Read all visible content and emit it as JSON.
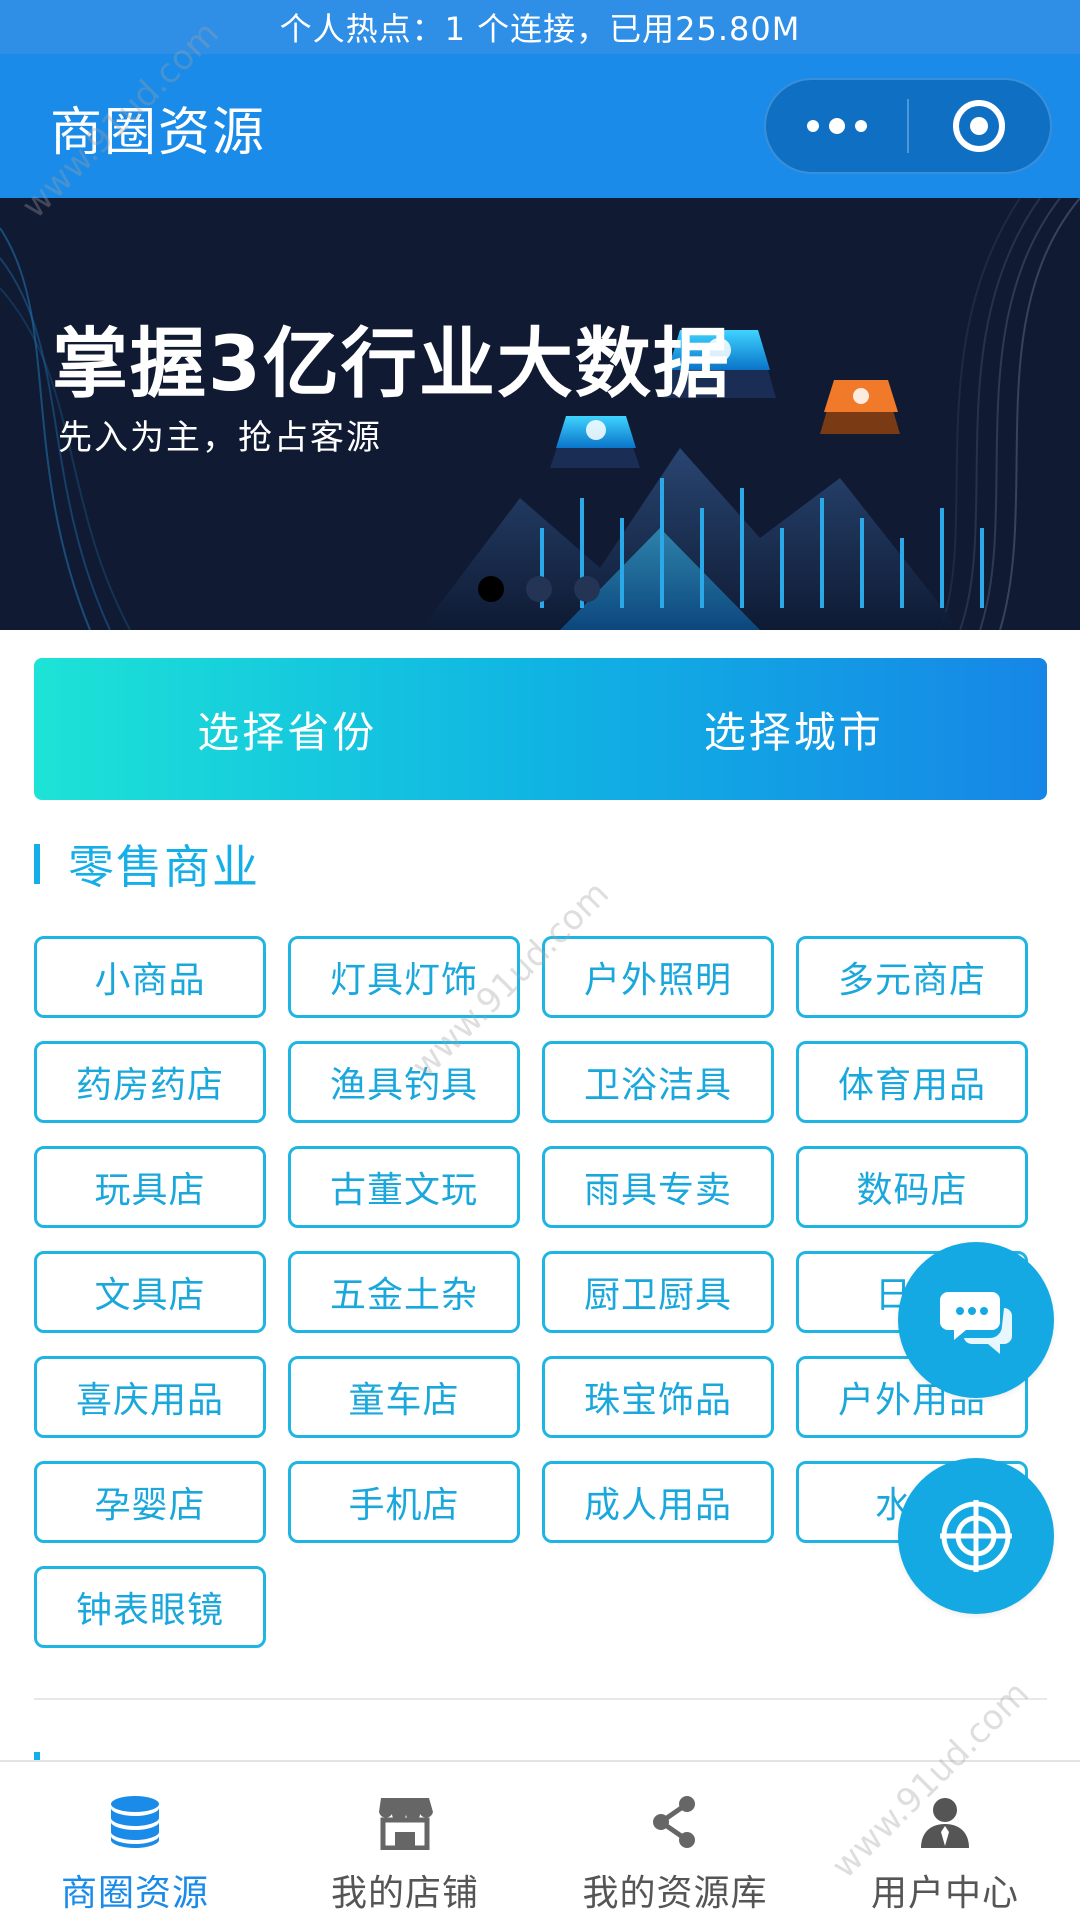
{
  "status_bar": {
    "text": "个人热点：1 个连接，已用25.80M"
  },
  "nav": {
    "title": "商圈资源",
    "more_icon": "more-dots-icon",
    "target_icon": "target-circle-icon"
  },
  "banner": {
    "title": "掌握3亿行业大数据",
    "subtitle": "先入为主，抢占客源",
    "slides": 3,
    "active_slide": 1
  },
  "selector": {
    "province_label": "选择省份",
    "city_label": "选择城市"
  },
  "section": {
    "title": "零售商业"
  },
  "categories": [
    "小商品",
    "灯具灯饰",
    "户外照明",
    "多元商店",
    "药房药店",
    "渔具钓具",
    "卫浴洁具",
    "体育用品",
    "玩具店",
    "古董文玩",
    "雨具专卖",
    "数码店",
    "文具店",
    "五金土杂",
    "厨卫厨具",
    "日化",
    "喜庆用品",
    "童车店",
    "珠宝饰品",
    "户外用品",
    "孕婴店",
    "手机店",
    "成人用品",
    "水泵",
    "钟表眼镜"
  ],
  "fabs": {
    "chat_icon": "chat-bubbles-icon",
    "radar_icon": "radar-target-icon"
  },
  "tab_bar": {
    "items": [
      {
        "label": "商圈资源",
        "icon": "database-icon",
        "active": true
      },
      {
        "label": "我的店铺",
        "icon": "store-icon",
        "active": false
      },
      {
        "label": "我的资源库",
        "icon": "share-icon",
        "active": false
      },
      {
        "label": "用户中心",
        "icon": "user-icon",
        "active": false
      }
    ]
  },
  "watermark": {
    "text": "www.91ud.com"
  },
  "colors": {
    "primary": "#1a8be8",
    "accent": "#14aee8",
    "banner_bg": "#101a33"
  }
}
